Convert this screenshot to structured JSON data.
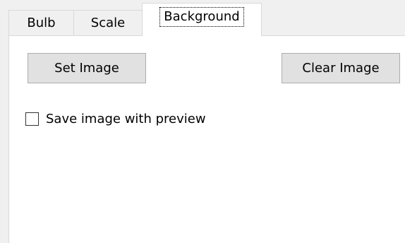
{
  "tabs": [
    {
      "label": "Bulb",
      "selected": false
    },
    {
      "label": "Scale",
      "selected": false
    },
    {
      "label": "Background",
      "selected": true
    }
  ],
  "background_tab": {
    "set_image_label": "Set Image",
    "clear_image_label": "Clear Image",
    "save_with_preview": {
      "label": "Save image with preview",
      "checked": false
    }
  },
  "colors": {
    "window_bg": "#f0f0f0",
    "panel_bg": "#ffffff",
    "button_bg": "#e1e1e1",
    "button_border": "#adadad"
  }
}
